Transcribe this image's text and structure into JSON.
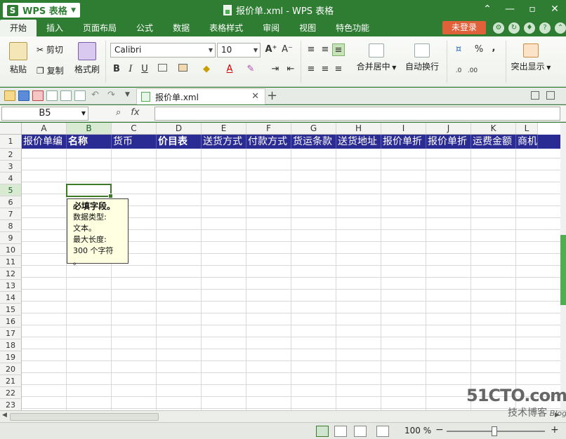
{
  "app": {
    "name": "WPS 表格",
    "logo": "S",
    "doc_title": "报价单.xml - WPS 表格"
  },
  "menu": {
    "items": [
      "开始",
      "插入",
      "页面布局",
      "公式",
      "数据",
      "表格样式",
      "审阅",
      "视图",
      "特色功能"
    ],
    "login": "未登录"
  },
  "ribbon": {
    "paste": "粘贴",
    "cut": "剪切",
    "copy": "复制",
    "format_painter": "格式刷",
    "font_name": "Calibri",
    "font_size": "10",
    "merge_center": "合并居中",
    "wrap_text": "自动换行",
    "highlight": "突出显示",
    "percent": "%",
    "comma": ","
  },
  "tabs": {
    "doc_tab": "报价单.xml"
  },
  "formula": {
    "name_box": "B5",
    "fx": "fx",
    "value": ""
  },
  "grid": {
    "columns": [
      "A",
      "B",
      "C",
      "D",
      "E",
      "F",
      "G",
      "H",
      "I",
      "J",
      "K",
      "L"
    ],
    "selected_column": "B",
    "rows": [
      "1",
      "2",
      "3",
      "4",
      "5",
      "6",
      "7",
      "8",
      "9",
      "10",
      "11",
      "12",
      "13",
      "14",
      "15",
      "16",
      "17",
      "18",
      "19",
      "20",
      "21",
      "22",
      "23"
    ],
    "selected_row": "5",
    "header_row": [
      "报价单编",
      "名称",
      "货币",
      "价目表",
      "送货方式",
      "付款方式",
      "货运条款",
      "送货地址",
      "报价单折",
      "报价单折",
      "运费金额",
      "商机"
    ],
    "active_cell": "B5"
  },
  "tooltip": {
    "title": "必填字段。",
    "line1": "数据类型:",
    "line2": "文本。",
    "line3": "最大长度:",
    "line4": "300 个字符",
    "line5": "。"
  },
  "status": {
    "zoom": "100 %"
  },
  "watermark": {
    "site": "51CTO.com",
    "line2": "技术博客",
    "line3": "Blog"
  },
  "colors": {
    "brand": "#2e7d32",
    "header_row": "#2b2b94",
    "login": "#e0603a"
  }
}
